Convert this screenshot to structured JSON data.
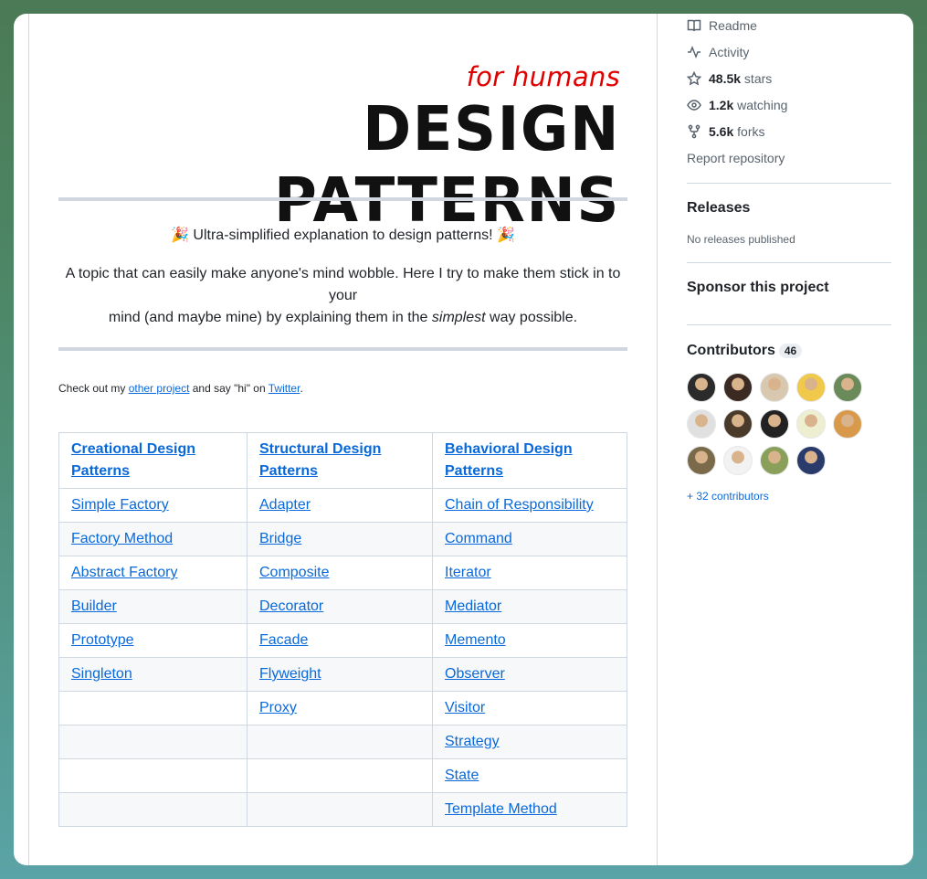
{
  "readme": {
    "for_humans": "for humans",
    "title": "DESIGN PATTERNS",
    "tagline": "🎉 Ultra-simplified explanation to design patterns! 🎉",
    "para_part1": "A topic that can easily make anyone's mind wobble. Here I try to make them stick in to your",
    "para_part2": "mind (and maybe mine) by explaining them in the ",
    "para_em": "simplest",
    "para_part3": " way possible.",
    "note_prefix": "Check out my ",
    "note_link1": "other project",
    "note_middle": " and say \"hi\" on ",
    "note_link2": "Twitter",
    "note_suffix": ".",
    "table": {
      "headers": [
        "Creational Design Patterns",
        "Structural Design Patterns",
        "Behavioral Design Patterns"
      ],
      "rows": [
        [
          "Simple Factory",
          "Adapter",
          "Chain of Responsibility"
        ],
        [
          "Factory Method",
          "Bridge",
          "Command"
        ],
        [
          "Abstract Factory",
          "Composite",
          "Iterator"
        ],
        [
          "Builder",
          "Decorator",
          "Mediator"
        ],
        [
          "Prototype",
          "Facade",
          "Memento"
        ],
        [
          "Singleton",
          "Flyweight",
          "Observer"
        ],
        [
          "",
          "Proxy",
          "Visitor"
        ],
        [
          "",
          "",
          "Strategy"
        ],
        [
          "",
          "",
          "State"
        ],
        [
          "",
          "",
          "Template Method"
        ]
      ]
    }
  },
  "sidebar": {
    "readme": "Readme",
    "activity": "Activity",
    "stars_count": "48.5k",
    "stars_label": " stars",
    "watching_count": "1.2k",
    "watching_label": " watching",
    "forks_count": "5.6k",
    "forks_label": " forks",
    "report": "Report repository",
    "releases_heading": "Releases",
    "releases_note": "No releases published",
    "sponsor_heading": "Sponsor this project",
    "contributors_heading": "Contributors",
    "contributors_count": "46",
    "more_contributors": "+ 32 contributors",
    "avatar_colors": [
      "#2b2b2b",
      "#3a2a22",
      "#d8c8b0",
      "#f0c84a",
      "#6b8a5a",
      "#e0e0e0",
      "#4a3a2a",
      "#222222",
      "#eeeed0",
      "#d89a4a",
      "#7a6a4a",
      "#f2f2f2",
      "#8aa05a",
      "#2a3a6a"
    ]
  }
}
